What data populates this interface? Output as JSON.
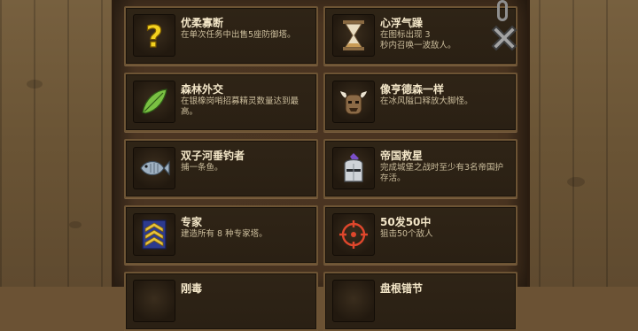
{
  "achievements": [
    {
      "title": "优柔寡断",
      "desc": "在单次任务中出售5座防御塔。",
      "icon": "question-mark-icon"
    },
    {
      "title": "心浮气躁",
      "desc": "在图标出现 3\n秒内召唤一波敌人。",
      "icon": "hourglass-icon"
    },
    {
      "title": "森林外交",
      "desc": "在银橡岗哨招募精灵数量达到最高。",
      "icon": "leaf-icon"
    },
    {
      "title": "像亨德森一样",
      "desc": "在冰风隘口释放大脚怪。",
      "icon": "yeti-icon"
    },
    {
      "title": "双子河垂钓者",
      "desc": "捕一条鱼。",
      "icon": "fish-icon"
    },
    {
      "title": "帝国救星",
      "desc": "完成城堡之战时至少有3名帝国护存活。",
      "icon": "knight-helmet-icon"
    },
    {
      "title": "专家",
      "desc": "建造所有 8 种专家塔。",
      "icon": "chevron-rank-icon"
    },
    {
      "title": "50发50中",
      "desc": "狙击50个敌人",
      "icon": "crosshair-icon"
    },
    {
      "title": "刚毒",
      "desc": "",
      "icon": "unknown-icon"
    },
    {
      "title": "盘根错节",
      "desc": "",
      "icon": "roots-icon"
    }
  ],
  "close_button": {
    "icon": "close-x-icon"
  }
}
